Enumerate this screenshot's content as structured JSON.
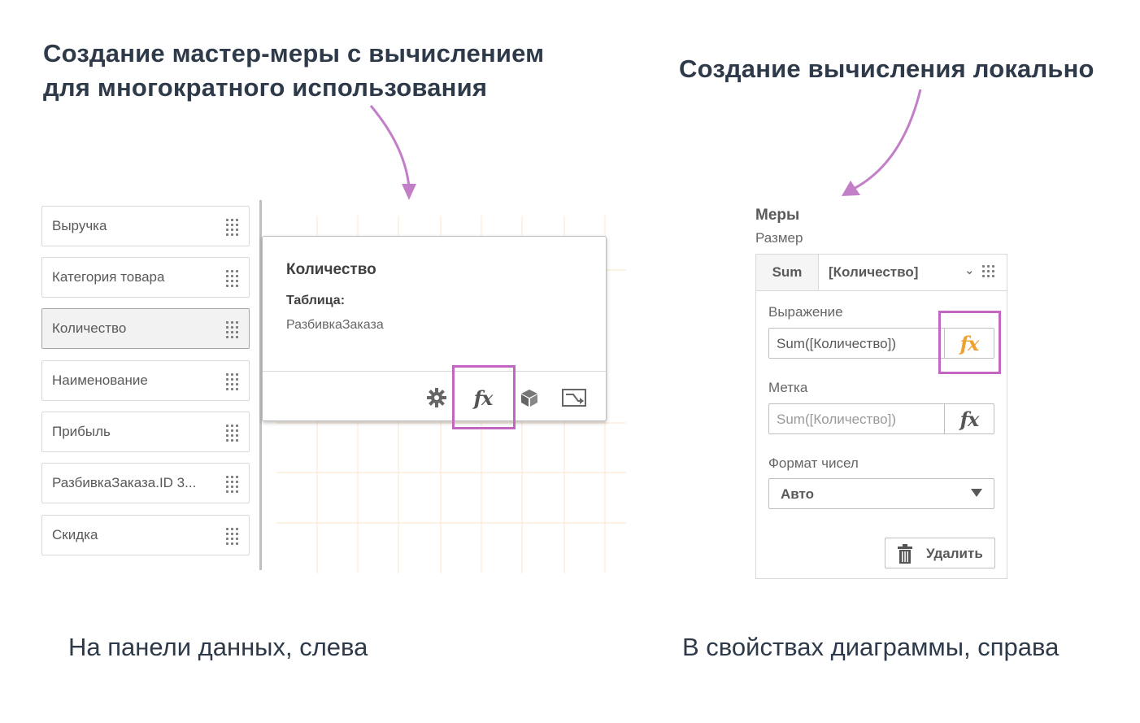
{
  "annotations": {
    "left_heading_line1": "Создание мастер-меры с вычислением",
    "left_heading_line2": "для многократного использования",
    "right_heading": "Создание вычисления локально",
    "left_caption": "На панели данных, слева",
    "right_caption": "В свойствах диаграммы, справа",
    "accent_color": "#c266c2"
  },
  "data_panel": {
    "fields": [
      {
        "label": "Выручка"
      },
      {
        "label": "Категория товара"
      },
      {
        "label": "Количество",
        "selected": true
      },
      {
        "label": "Наименование"
      },
      {
        "label": "Прибыль"
      },
      {
        "label": "РазбивкаЗаказа.ID 3..."
      },
      {
        "label": "Скидка"
      }
    ]
  },
  "popover": {
    "title": "Количество",
    "table_label": "Таблица:",
    "table_value": "РазбивкаЗаказа",
    "icons": [
      "gear-icon",
      "fx-icon",
      "cube-icon",
      "chart-icon"
    ],
    "fx_label": "fx"
  },
  "properties": {
    "section_title": "Меры",
    "subtitle": "Размер",
    "aggregation": "Sum",
    "field": "[Количество]",
    "expression_label": "Выражение",
    "expression_value": "Sum([Количество])",
    "label_label": "Метка",
    "label_placeholder": "Sum([Количество])",
    "number_format_label": "Формат чисел",
    "number_format_value": "Авто",
    "delete_label": "Удалить",
    "fx_label": "fx",
    "fx_active_color": "#f0a030"
  }
}
